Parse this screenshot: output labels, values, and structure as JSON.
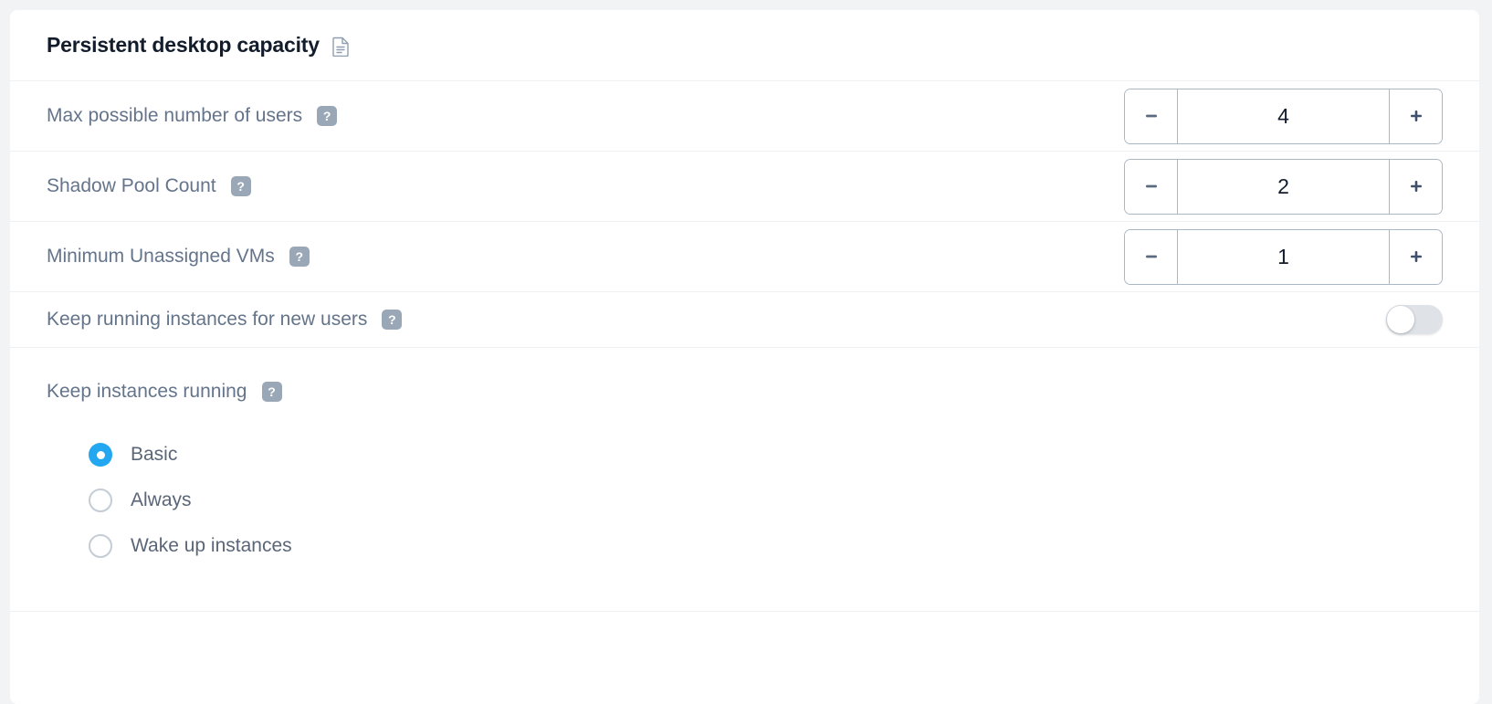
{
  "card": {
    "title": "Persistent desktop capacity",
    "title_icon": "document-icon"
  },
  "help_icon_glyph": "?",
  "stepper_rows": [
    {
      "label": "Max possible number of users",
      "help": "help-icon",
      "value": "4",
      "decrement_label": "−",
      "increment_label": "+"
    },
    {
      "label": "Shadow Pool Count",
      "help": "help-icon",
      "value": "2",
      "decrement_label": "−",
      "increment_label": "+"
    },
    {
      "label": "Minimum Unassigned VMs",
      "help": "help-icon",
      "value": "1",
      "decrement_label": "−",
      "increment_label": "+"
    }
  ],
  "toggle_row": {
    "label": "Keep running instances for new users",
    "help": "help-icon",
    "state": "off"
  },
  "radio_group": {
    "label": "Keep instances running",
    "help": "help-icon",
    "selected": "Basic",
    "options": [
      {
        "label": "Basic"
      },
      {
        "label": "Always"
      },
      {
        "label": "Wake up instances"
      }
    ]
  },
  "colors": {
    "page_background": "#f1f3f5",
    "card_background": "#ffffff",
    "title_text": "#121c2b",
    "label_text": "#64748b",
    "divider": "#eef0f2",
    "stepper_border": "#aab7c4",
    "help_badge": "#9aa7b6",
    "radio_accent": "#22a7f0",
    "toggle_track_off": "#dfe3e8"
  }
}
